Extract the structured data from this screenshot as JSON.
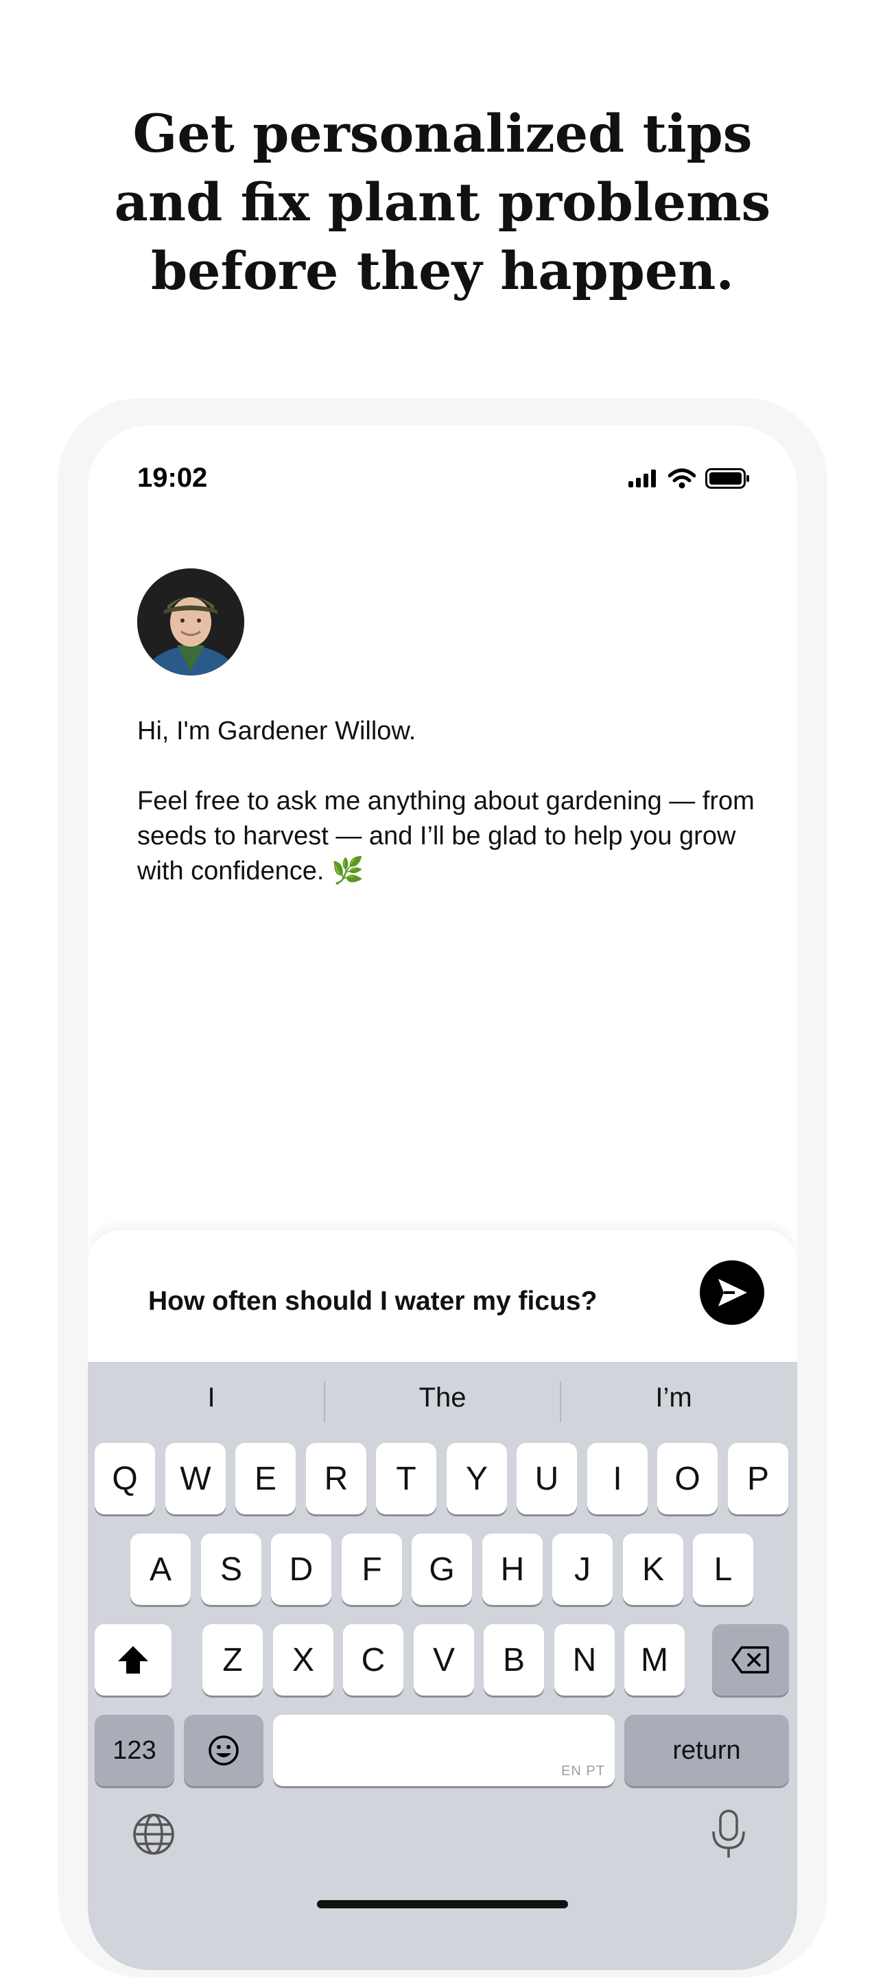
{
  "headline": "Get personalized tips and fix plant problems before they happen.",
  "status_bar": {
    "time": "19:02",
    "icons": [
      "signal-icon",
      "wifi-icon",
      "battery-icon"
    ]
  },
  "assistant": {
    "greeting": "Hi, I'm Gardener Willow.",
    "message": "Feel free to ask me anything about gardening — from seeds to harvest — and I’ll be glad to help you grow with confidence. 🌿"
  },
  "composer": {
    "text": "How often should I water my ficus?"
  },
  "keyboard": {
    "suggestions": [
      "I",
      "The",
      "I’m"
    ],
    "row1": [
      "Q",
      "W",
      "E",
      "R",
      "T",
      "Y",
      "U",
      "I",
      "O",
      "P"
    ],
    "row2": [
      "A",
      "S",
      "D",
      "F",
      "G",
      "H",
      "J",
      "K",
      "L"
    ],
    "row3": [
      "Z",
      "X",
      "C",
      "V",
      "B",
      "N",
      "M"
    ],
    "numbers_key": "123",
    "return_key": "return",
    "space_hint": "EN PT"
  },
  "colors": {
    "accent": "#000000",
    "keyboard_bg": "#d1d4db",
    "key_dark": "#a9adb7"
  }
}
